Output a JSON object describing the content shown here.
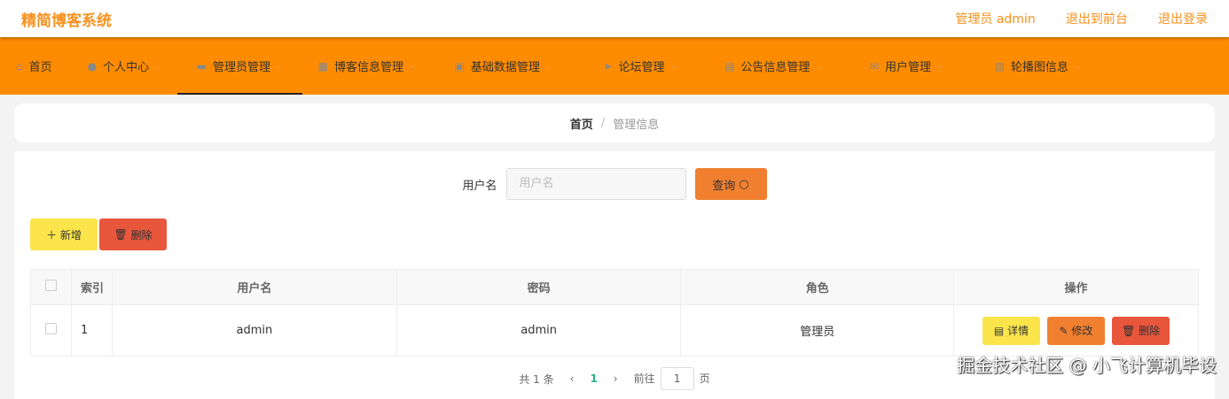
{
  "header": {
    "title": "精简博客系统",
    "user": "管理员 admin",
    "front": "退出到前台",
    "logout": "退出登录"
  },
  "nav": [
    {
      "label": "首页",
      "icon": "home-icon"
    },
    {
      "label": "个人中心",
      "icon": "user-icon"
    },
    {
      "label": "管理员管理",
      "icon": "monitor-icon"
    },
    {
      "label": "博客信息管理",
      "icon": "grid-icon"
    },
    {
      "label": "基础数据管理",
      "icon": "briefcase-icon"
    },
    {
      "label": "论坛管理",
      "icon": "send-icon"
    },
    {
      "label": "公告信息管理",
      "icon": "document-icon"
    },
    {
      "label": "用户管理",
      "icon": "mail-icon"
    },
    {
      "label": "轮播图信息",
      "icon": "image-icon"
    }
  ],
  "breadcrumb": {
    "home": "首页",
    "sep": "/",
    "current": "管理信息"
  },
  "search": {
    "label": "用户名",
    "placeholder": "用户名",
    "button": "查询"
  },
  "actions": {
    "add": "新增",
    "delete": "删除"
  },
  "table": {
    "headers": [
      "索引",
      "用户名",
      "密码",
      "角色",
      "操作"
    ],
    "rows": [
      {
        "index": "1",
        "username": "admin",
        "password": "admin",
        "role": "管理员"
      }
    ],
    "ops": {
      "detail": "详情",
      "edit": "修改",
      "delete": "删除"
    }
  },
  "pagination": {
    "total": "共 1 条",
    "prev": "‹",
    "page": "1",
    "next": "›",
    "goto": "前往",
    "goto_value": "1",
    "page_suffix": "页"
  },
  "watermark": "掘金技术社区 @ 小飞计算机毕设"
}
